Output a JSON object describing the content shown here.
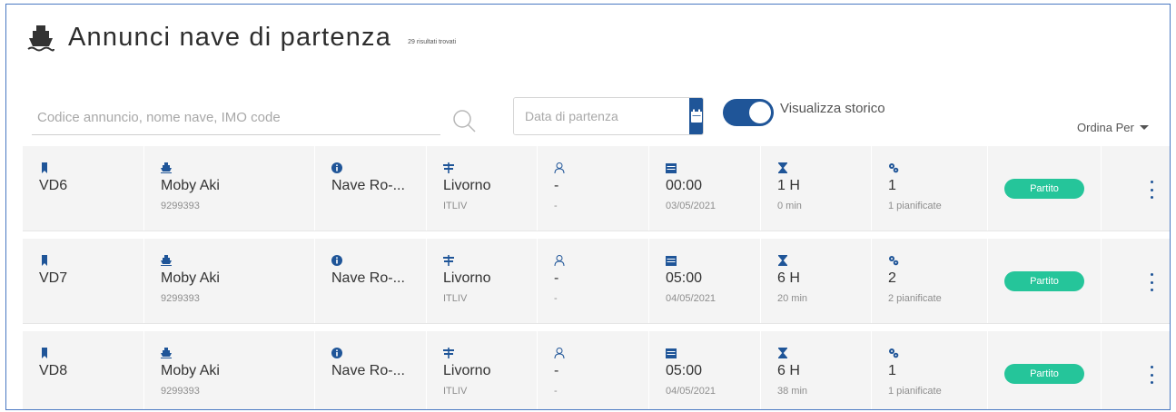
{
  "header": {
    "title": "Annunci nave di partenza",
    "results": "29 risultati trovati"
  },
  "filters": {
    "search_placeholder": "Codice annuncio, nome nave, IMO code",
    "date_placeholder": "Data di partenza",
    "history_toggle_label": "Visualizza storico",
    "history_toggle_on": true,
    "sort_label": "Ordina Per"
  },
  "colors": {
    "primary": "#1f5598",
    "status_green": "#25c59a",
    "row_bg": "#f4f4f4"
  },
  "rows": [
    {
      "code": "VD6",
      "ship_name": "Moby Aki",
      "imo": "9299393",
      "ship_type": "Nave Ro-...",
      "port": "Livorno",
      "port_code": "ITLIV",
      "agent": "-",
      "agent_sub": "-",
      "time": "00:00",
      "date": "03/05/2021",
      "duration_h": "1 H",
      "duration_min": "0 min",
      "operations": "1",
      "operations_sub": "1 pianificate",
      "status": "Partito"
    },
    {
      "code": "VD7",
      "ship_name": "Moby Aki",
      "imo": "9299393",
      "ship_type": "Nave Ro-...",
      "port": "Livorno",
      "port_code": "ITLIV",
      "agent": "-",
      "agent_sub": "-",
      "time": "05:00",
      "date": "04/05/2021",
      "duration_h": "6 H",
      "duration_min": "20 min",
      "operations": "2",
      "operations_sub": "2 pianificate",
      "status": "Partito"
    },
    {
      "code": "VD8",
      "ship_name": "Moby Aki",
      "imo": "9299393",
      "ship_type": "Nave Ro-...",
      "port": "Livorno",
      "port_code": "ITLIV",
      "agent": "-",
      "agent_sub": "-",
      "time": "05:00",
      "date": "04/05/2021",
      "duration_h": "6 H",
      "duration_min": "38 min",
      "operations": "1",
      "operations_sub": "1 pianificate",
      "status": "Partito"
    }
  ]
}
